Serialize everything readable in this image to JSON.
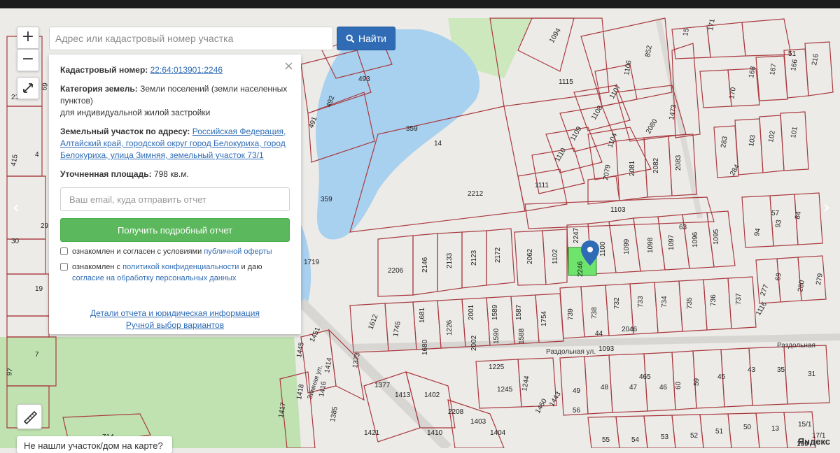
{
  "search": {
    "placeholder": "Адрес или кадастровый номер участка",
    "button_label": "Найти"
  },
  "controls": {
    "zoom_in": "+",
    "zoom_out": "−"
  },
  "info": {
    "cadastral_label": "Кадастровый номер:",
    "cadastral_value": "22:64:013901:2246",
    "category_label": "Категория земель:",
    "category_value": "Земли поселений (земли населенных пунктов)",
    "category_use": "для индивидуальной жилой застройки",
    "address_label": "Земельный участок по адресу:",
    "address_value": "Российская Федерация, Алтайский край, городской округ город Белокуриха, город Белокуриха, улица Зимняя, земельный участок 73/1",
    "area_label": "Уточненная площадь:",
    "area_value": "798 кв.м.",
    "email_placeholder": "Ваш email, куда отправить отчет",
    "report_button": "Получить подробный отчет",
    "consent1_text": "ознакомлен и согласен с условиями ",
    "consent1_link": "публичной оферты",
    "consent2_text": "ознакомлен с ",
    "consent2_link": "политикой конфиденциальности",
    "consent2_mid": " и даю ",
    "consent2_link2": "согласие на обработку персональных данных",
    "details_link": "Детали отчета и юридическая информация",
    "manual_link": "Ручной выбор вариантов",
    "close": "×"
  },
  "not_found": "Не нашли участок/дом на карте?",
  "yandex": "Яндекс",
  "map": {
    "water_label": "359",
    "selected_plot": "2246",
    "streets": [
      "Раздольная ул.",
      "Раздольная",
      "Зимняя ул."
    ],
    "plot_labels": [
      "493",
      "492",
      "491",
      "1115",
      "1094",
      "852",
      "1106",
      "1107",
      "1108",
      "1109",
      "1110",
      "1111",
      "1104",
      "1473",
      "2080",
      "2079",
      "2081",
      "2082",
      "2083",
      "2212",
      "14",
      "1103",
      "2206",
      "2146",
      "2133",
      "2123",
      "2172",
      "2062",
      "1102",
      "2247",
      "1100",
      "1099",
      "1098",
      "1097",
      "1096",
      "1095",
      "63",
      "1719",
      "359",
      "1612",
      "1745",
      "1681",
      "1226",
      "2001",
      "1589",
      "1587",
      "1754",
      "739",
      "738",
      "732",
      "733",
      "734",
      "735",
      "736",
      "737",
      "1116",
      "1680",
      "2002",
      "1590",
      "1588",
      "44",
      "2046",
      "1093",
      "1225",
      "1451",
      "1445",
      "1414",
      "1373",
      "1377",
      "1416",
      "1418",
      "1385",
      "1417",
      "1413",
      "1402",
      "1421",
      "1410",
      "1403",
      "1404",
      "2208",
      "1245",
      "1244",
      "1460",
      "1443",
      "49",
      "48",
      "47",
      "465",
      "46",
      "60",
      "59",
      "45",
      "43",
      "35",
      "31",
      "56",
      "55",
      "54",
      "53",
      "52",
      "51",
      "50",
      "13",
      "15/1",
      "17/1",
      "169",
      "168",
      "167",
      "166",
      "216",
      "15",
      "171",
      "170",
      "51",
      "283",
      "103",
      "102",
      "101",
      "284",
      "94",
      "93",
      "84",
      "57",
      "69",
      "280",
      "279",
      "277",
      "714",
      "29",
      "30",
      "19",
      "7",
      "97",
      "4",
      "415",
      "21",
      "69"
    ]
  }
}
